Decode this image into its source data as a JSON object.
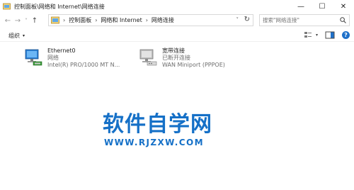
{
  "window": {
    "title": "控制面板\\网络和 Internet\\网络连接",
    "minimize": "—",
    "maximize": "☐",
    "close": "✕"
  },
  "nav": {
    "back": "←",
    "forward": "→",
    "recent": "˅",
    "up": "↑",
    "breadcrumbs": [
      "控制面板",
      "网络和 Internet",
      "网络连接"
    ],
    "separator": "›",
    "address_dropdown": "˅",
    "refresh": "↻"
  },
  "search": {
    "placeholder": "搜索\"网络连接\""
  },
  "toolbar": {
    "organize_label": "组织",
    "organize_caret": "▾",
    "view_caret": "▾",
    "help": "?"
  },
  "connections": [
    {
      "name": "Ethernet0",
      "status": "网络",
      "device": "Intel(R) PRO/1000 MT N...",
      "icon": "ethernet-adapter-icon"
    },
    {
      "name": "宽带连接",
      "status": "已断开连接",
      "device": "WAN Miniport (PPPOE)",
      "icon": "broadband-modem-icon"
    }
  ],
  "watermark": {
    "title": "软件自学网",
    "url": "WWW.RJZXW.COM",
    "color": "#1570c7"
  },
  "colors": {
    "accent": "#1e70c9",
    "secondary_text": "#6d6d6d"
  }
}
